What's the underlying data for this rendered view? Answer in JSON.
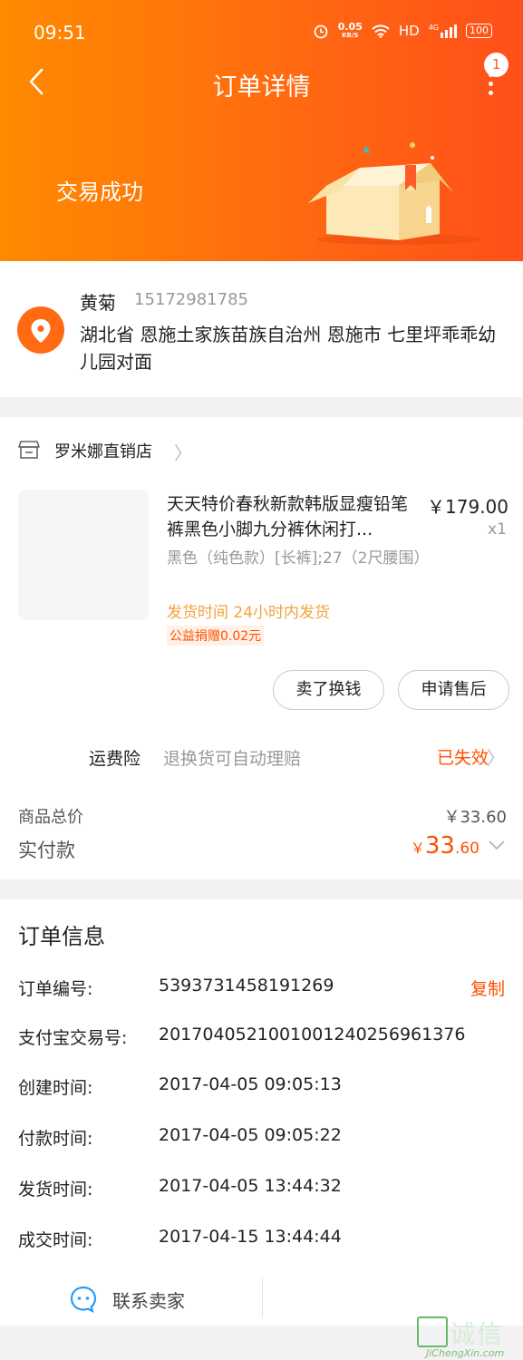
{
  "status_bar": {
    "time": "09:51",
    "net_speed_value": "0.05",
    "net_speed_unit": "KB/S",
    "hd": "HD",
    "cell": "4G",
    "battery": "100"
  },
  "nav": {
    "title": "订单详情",
    "badge_count": "1"
  },
  "order_status": {
    "title": "交易成功"
  },
  "address": {
    "name": "黄菊",
    "phone": "15172981785",
    "detail": "湖北省 恩施土家族苗族自治州 恩施市 七里坪乖乖幼儿园对面"
  },
  "shop": {
    "name": "罗米娜直销店"
  },
  "item": {
    "title": "天天特价春秋新款韩版显瘦铅笔裤黑色小脚九分裤休闲打...",
    "price": "￥179.00",
    "qty": "x1",
    "sku": "黑色（纯色款）[长裤];27（2尺腰围）",
    "ship_time": "发货时间 24小时内发货",
    "charity": "公益捐赠0.02元"
  },
  "actions": {
    "sell": "卖了换钱",
    "after_sale": "申请售后"
  },
  "insurance": {
    "label": "运费险",
    "desc": "退换货可自动理赔",
    "status": "已失效"
  },
  "totals": {
    "goods_label": "商品总价",
    "goods_value": "￥33.60",
    "paid_label": "实付款",
    "paid_currency": "￥",
    "paid_int": "33",
    "paid_dec": ".60"
  },
  "order_info": {
    "title": "订单信息",
    "copy": "复制",
    "rows": [
      {
        "label": "订单编号:",
        "value": "5393731458191269"
      },
      {
        "label": "支付宝交易号:",
        "value": "2017040521001001240256961376"
      },
      {
        "label": "创建时间:",
        "value": "2017-04-05 09:05:13"
      },
      {
        "label": "付款时间:",
        "value": "2017-04-05 09:05:22"
      },
      {
        "label": "发货时间:",
        "value": "2017-04-05 13:44:32"
      },
      {
        "label": "成交时间:",
        "value": "2017-04-15 13:44:44"
      }
    ]
  },
  "contact": {
    "label": "联系卖家"
  },
  "watermark": {
    "text": "诚信",
    "url": "JiChengXin.com"
  },
  "colors": {
    "accent": "#ff5000",
    "header_start": "#ff8a00",
    "header_end": "#ff4f1a",
    "ship_time": "#f2a23b"
  }
}
